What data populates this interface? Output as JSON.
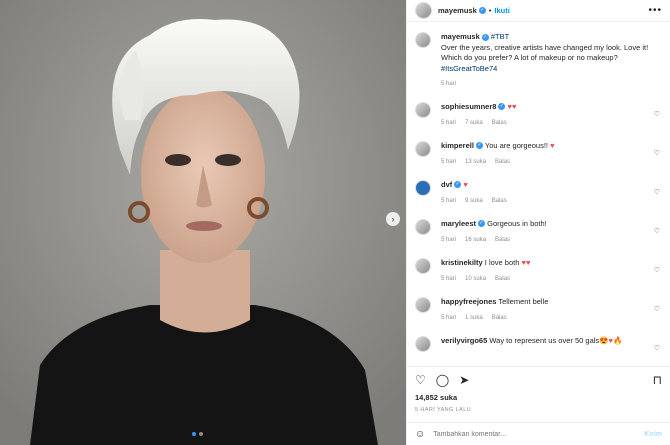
{
  "post": {
    "username": "mayemusk",
    "follow_label": "Ikuti",
    "more_icon": "•••",
    "caption_user": "mayemusk",
    "caption_hashtag_tbt": "#TBT",
    "caption_text": "Over the years, creative artists have changed my look. Love it! Which do you prefer? A lot of makeup or no makeup?",
    "caption_hashtag_end": "#ItsGreatToBe74",
    "caption_time": "5 hari",
    "likes": "14,852 suka",
    "date": "5 HARI YANG LALU",
    "carousel_next": "›"
  },
  "comments": [
    {
      "user": "sophiesumner8",
      "verified": true,
      "text": "",
      "emoji": "♥♥",
      "time": "5 hari",
      "likes": "7 suka",
      "reply": "Balas"
    },
    {
      "user": "kimperell",
      "verified": true,
      "text": "You are gorgeous!!",
      "emoji": "♥",
      "time": "5 hari",
      "likes": "13 suka",
      "reply": "Balas"
    },
    {
      "user": "dvf",
      "verified": true,
      "text": "",
      "emoji": "♥",
      "time": "5 hari",
      "likes": "9 suka",
      "reply": "Balas"
    },
    {
      "user": "maryleest",
      "verified": true,
      "text": "Gorgeous in both!",
      "emoji": "",
      "time": "5 hari",
      "likes": "16 suka",
      "reply": "Balas"
    },
    {
      "user": "kristinekilty",
      "verified": false,
      "text": "I love both",
      "emoji": "♥♥",
      "time": "5 hari",
      "likes": "10 suka",
      "reply": "Balas"
    },
    {
      "user": "happyfreejones",
      "verified": false,
      "text": "Tellement belle",
      "emoji": "",
      "time": "5 hari",
      "likes": "1 suka",
      "reply": "Balas"
    },
    {
      "user": "verilyvirgo65",
      "verified": false,
      "text": "Way to represent us over 50 gals",
      "emoji": "😍♥🔥",
      "time": "",
      "likes": "",
      "reply": ""
    }
  ],
  "composer": {
    "placeholder": "Tambahkan komentar...",
    "post_label": "Kirim"
  },
  "colors": {
    "link": "#0095f6",
    "heart": "#ed4956",
    "muted": "#8e8e8e"
  }
}
